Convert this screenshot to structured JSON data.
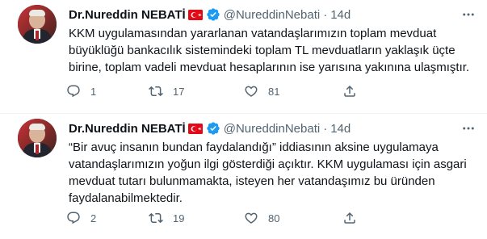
{
  "colors": {
    "text": "#0f1419",
    "muted": "#536471",
    "verified": "#1d9bf0",
    "flag_red": "#e30a17",
    "divider": "#eff3f4"
  },
  "tweets": [
    {
      "author_name": "Dr.Nureddin NEBATİ",
      "handle": "@NureddinNebati",
      "separator": "·",
      "time": "14d",
      "text_lines": [
        "KKM uygulamasından yararlanan vatandaşlarımızın toplam mevduat",
        "büyüklüğü bankacılık sistemindeki toplam TL mevduatların yaklaşık üçte",
        "birine, toplam vadeli mevduat hesaplarının ise yarısına yakınına ulaşmıştır."
      ],
      "replies": "1",
      "retweets": "17",
      "likes": "81"
    },
    {
      "author_name": "Dr.Nureddin NEBATİ",
      "handle": "@NureddinNebati",
      "separator": "·",
      "time": "14d",
      "text_lines": [
        "“Bir avuç insanın bundan faydalandığı” iddiasının aksine uygulamaya",
        "vatandaşlarımızın yoğun ilgi gösterdiği açıktır. KKM uygulaması için asgari",
        "mevduat tutarı bulunmamakta, isteyen her vatandaşımız bu üründen",
        "faydalanabilmektedir."
      ],
      "replies": "2",
      "retweets": "19",
      "likes": "80"
    }
  ],
  "icons": {
    "flag": "turkey-flag-icon",
    "verified": "verified-badge-icon",
    "more": "more-horizontal-icon",
    "reply": "reply-icon",
    "retweet": "retweet-icon",
    "like": "heart-icon",
    "share": "share-icon"
  }
}
